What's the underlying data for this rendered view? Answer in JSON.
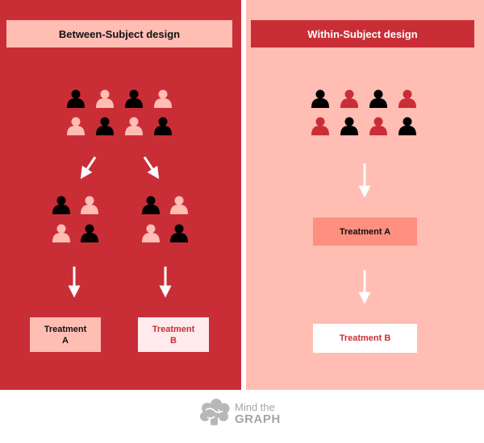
{
  "left": {
    "title": "Between-Subject design",
    "treatment_a": {
      "line1": "Treatment",
      "line2": "A"
    },
    "treatment_b": {
      "line1": "Treatment",
      "line2": "B"
    }
  },
  "right": {
    "title": "Within-Subject design",
    "treatment_a": "Treatment A",
    "treatment_b": "Treatment B"
  },
  "logo": {
    "line1": "Mind the",
    "line2": "GRAPH"
  },
  "colors": {
    "red": "#c92e37",
    "pink": "#ffbdb4",
    "salmon": "#ff8f7e",
    "black": "#000000",
    "white": "#ffffff",
    "logo_gray": "#a5a5a5"
  },
  "icons": {
    "person": "person-icon",
    "arrow": "down-arrow-icon",
    "logo": "brain-logo-icon"
  }
}
